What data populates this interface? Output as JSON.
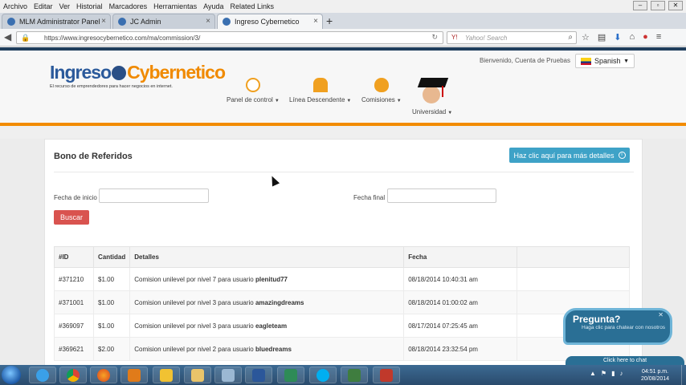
{
  "browser": {
    "menu": [
      "Archivo",
      "Editar",
      "Ver",
      "Historial",
      "Marcadores",
      "Herramientas",
      "Ayuda",
      "Related Links"
    ],
    "tabs": [
      {
        "label": "MLM Administrator Panel",
        "active": false
      },
      {
        "label": "JC Admin",
        "active": false
      },
      {
        "label": "Ingreso Cybernetico",
        "active": true
      }
    ],
    "url": "https://www.ingresocybernetico.com/ma/commission/3/",
    "search_placeholder": "Yahoo! Search"
  },
  "site": {
    "logo_text_1": "Ingreso",
    "logo_text_2": "Cybernetico",
    "tagline": "El recurso de emprendedores para hacer negocios en internet.",
    "welcome": "Bienvenido, Cuenta de Pruebas",
    "language": "Spanish",
    "nav": [
      {
        "label": "Panel de control",
        "icon": "clock-icon"
      },
      {
        "label": "Línea Descendente",
        "icon": "people-icon"
      },
      {
        "label": "Comisiones",
        "icon": "money-bag-icon"
      },
      {
        "label": "Universidad",
        "icon": "graduation-cap-icon"
      }
    ]
  },
  "panel": {
    "title": "Bono de Referidos",
    "details_button": "Haz clic aquí para más detalles",
    "start_label": "Fecha de inicio",
    "end_label": "Fecha final",
    "search_button": "Buscar",
    "table": {
      "headers": [
        "#ID",
        "Cantidad",
        "Detalles",
        "Fecha",
        ""
      ],
      "rows": [
        {
          "id": "#371210",
          "amount": "$1.00",
          "detail": "Comision unilevel por nivel 7 para usuario ",
          "user": "plenitud77",
          "date": "08/18/2014 10:40:31 am"
        },
        {
          "id": "#371001",
          "amount": "$1.00",
          "detail": "Comision unilevel por nivel 3 para usuario ",
          "user": "amazingdreams",
          "date": "08/18/2014 01:00:02 am"
        },
        {
          "id": "#369097",
          "amount": "$1.00",
          "detail": "Comision unilevel por nivel 3 para usuario ",
          "user": "eagleteam",
          "date": "08/17/2014 07:25:45 am"
        },
        {
          "id": "#369621",
          "amount": "$2.00",
          "detail": "Comision unilevel por nivel 2 para usuario ",
          "user": "bluedreams",
          "date": "08/18/2014 23:32:54 pm"
        }
      ]
    }
  },
  "chat": {
    "title": "Pregunta?",
    "subtitle": "Haga clic para chatear con nosotros",
    "bar": "Click here to chat"
  },
  "taskbar": {
    "time": "04:51 p.m.",
    "date": "20/08/2014"
  }
}
